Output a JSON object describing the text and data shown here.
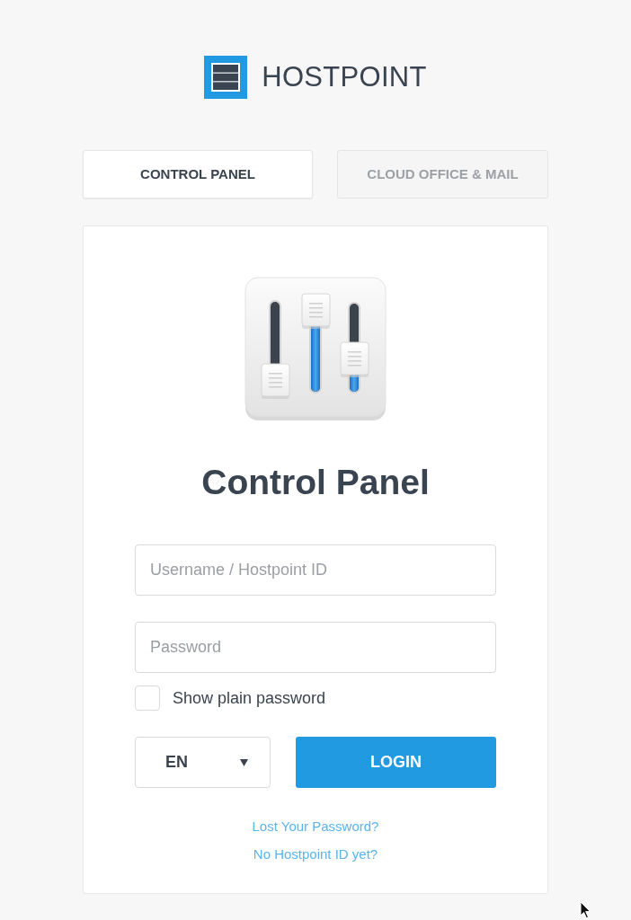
{
  "logo": {
    "text": "HOSTPOINT"
  },
  "tabs": [
    {
      "label": "CONTROL PANEL",
      "selected": true
    },
    {
      "label": "CLOUD OFFICE & MAIL",
      "selected": false
    }
  ],
  "panel": {
    "title": "Control Panel",
    "username": {
      "placeholder": "Username / Hostpoint ID"
    },
    "password": {
      "placeholder": "Password"
    },
    "show_password": {
      "label": "Show plain password",
      "checked": false
    },
    "language": {
      "value": "EN"
    },
    "login_button": "LOGIN",
    "links": [
      "Lost Your Password?",
      "No Hostpoint ID yet?"
    ]
  }
}
